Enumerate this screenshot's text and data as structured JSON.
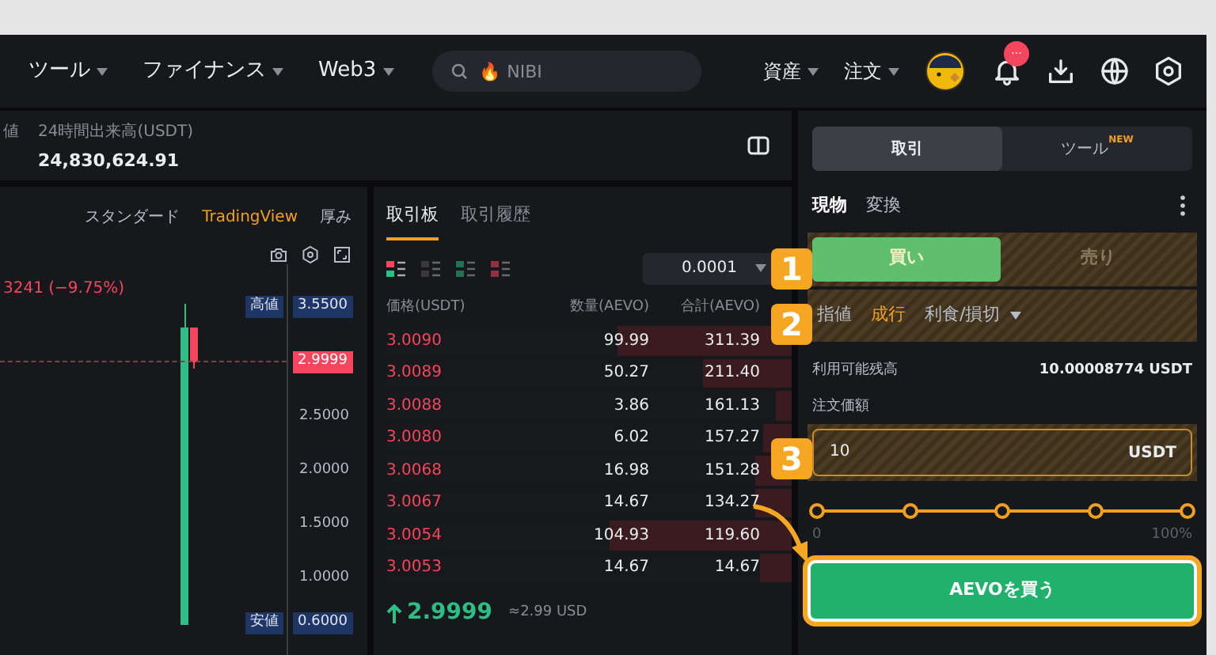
{
  "nav": {
    "menus": [
      {
        "label": "ツール"
      },
      {
        "label": "ファイナンス"
      },
      {
        "label": "Web3"
      }
    ],
    "search": {
      "placeholder": "🔥 NIBI"
    },
    "right_menus": [
      {
        "label": "資産"
      },
      {
        "label": "注文"
      }
    ],
    "notification_badge": "···"
  },
  "ticker": {
    "cut_label": "値",
    "volume_label": "24時間出来高(USDT)",
    "volume_value": "24,830,624.91"
  },
  "chart": {
    "views": [
      {
        "label": "スタンダード",
        "selected": false
      },
      {
        "label": "TradingView",
        "selected": true
      },
      {
        "label": "厚み",
        "selected": false
      }
    ],
    "change": "3241 (−9.75%)",
    "high_tag": "高値",
    "high_value": "3.5500",
    "last_price_tag": "2.9999",
    "low_tag": "安値",
    "low_value": "0.6000",
    "y_labels": [
      "2.5000",
      "2.0000",
      "1.5000",
      "1.0000"
    ]
  },
  "order_book": {
    "tabs": [
      {
        "label": "取引板",
        "selected": true
      },
      {
        "label": "取引履歴",
        "selected": false
      }
    ],
    "views": [
      {
        "kind": "both",
        "selected": true
      },
      {
        "kind": "grid",
        "selected": false
      },
      {
        "kind": "bids",
        "selected": false
      },
      {
        "kind": "asks",
        "selected": false
      }
    ],
    "precision": "0.0001",
    "columns": [
      "価格(USDT)",
      "数量(AEVO)",
      "合計(AEVO)"
    ],
    "rows": [
      {
        "price": "3.0090",
        "amount": "99.99",
        "total": "311.39",
        "level": 0.43
      },
      {
        "price": "3.0089",
        "amount": "50.27",
        "total": "211.40",
        "level": 0.22
      },
      {
        "price": "3.0088",
        "amount": "3.86",
        "total": "161.13",
        "level": 0.04
      },
      {
        "price": "3.0080",
        "amount": "6.02",
        "total": "157.27",
        "level": 0.07
      },
      {
        "price": "3.0068",
        "amount": "16.98",
        "total": "151.28",
        "level": 0.09
      },
      {
        "price": "3.0067",
        "amount": "14.67",
        "total": "134.27",
        "level": 0.09
      },
      {
        "price": "3.0054",
        "amount": "104.93",
        "total": "119.60",
        "level": 0.45
      },
      {
        "price": "3.0053",
        "amount": "14.67",
        "total": "14.67",
        "level": 0.08
      }
    ],
    "last_price": "2.9999",
    "last_price_rising": true,
    "last_price_usd": "≈2.99 USD"
  },
  "trade": {
    "tabs": [
      {
        "label": "取引",
        "selected": true
      },
      {
        "label": "ツール",
        "selected": false,
        "badge": "NEW"
      }
    ],
    "modes": [
      {
        "label": "現物",
        "selected": true
      },
      {
        "label": "変換",
        "selected": false
      }
    ],
    "sides": [
      {
        "label": "買い",
        "selected": true
      },
      {
        "label": "売り",
        "selected": false
      }
    ],
    "order_types": [
      {
        "label": "指値",
        "selected": false,
        "dropdown": false
      },
      {
        "label": "成行",
        "selected": true,
        "dropdown": false
      },
      {
        "label": "利食/損切",
        "selected": false,
        "dropdown": true
      }
    ],
    "balance_label": "利用可能残高",
    "balance_value": "10.00008774 USDT",
    "amount_label": "注文価額",
    "amount_value": "10",
    "amount_unit": "USDT",
    "slider": {
      "level": 1,
      "min_label": "0",
      "max_label": "100%"
    },
    "submit": "AEVOを買う"
  },
  "callouts": [
    "1",
    "2",
    "3"
  ]
}
